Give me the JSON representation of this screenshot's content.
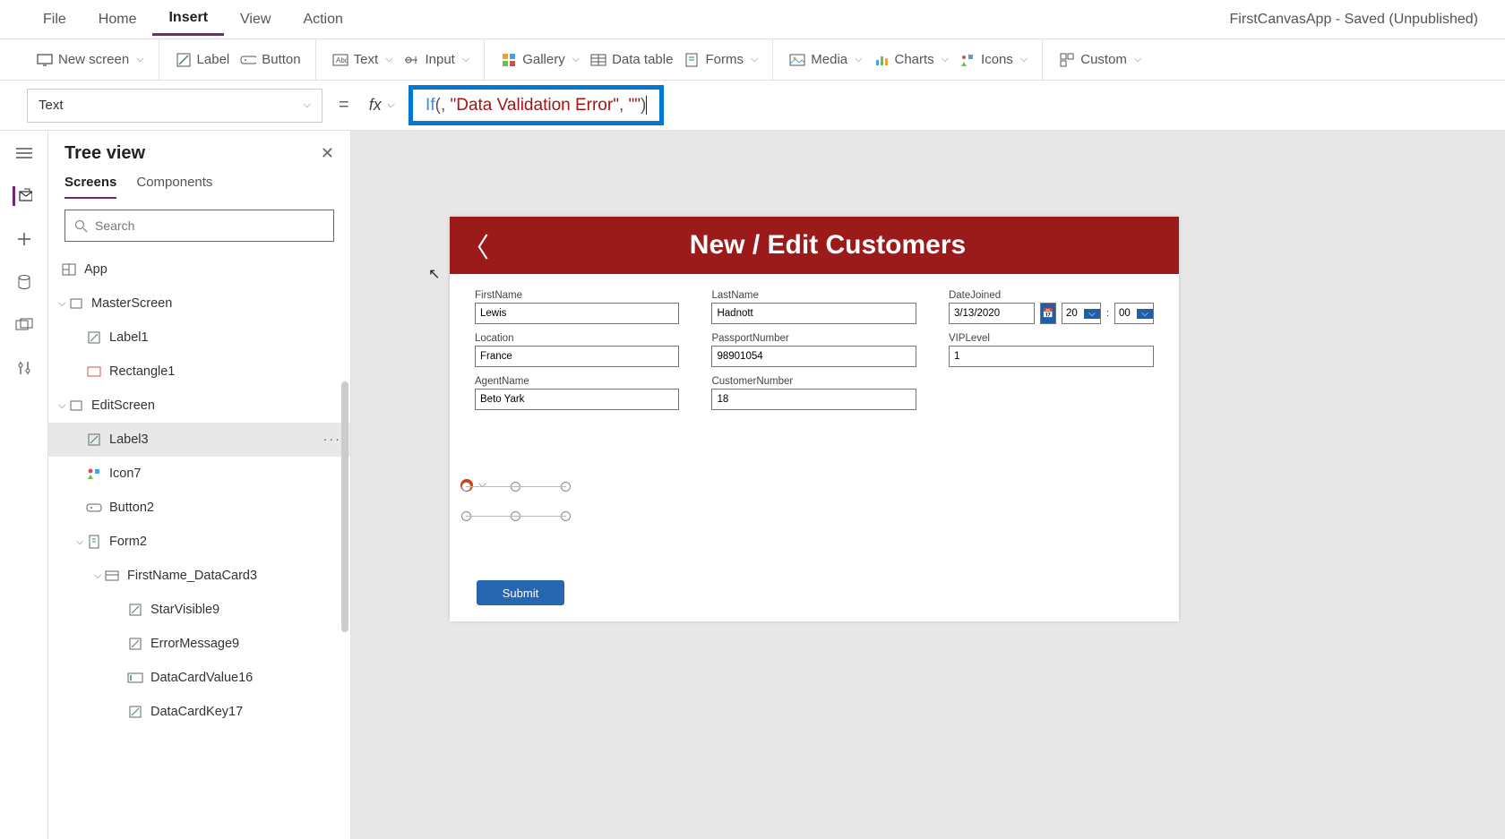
{
  "app": {
    "title": "FirstCanvasApp - Saved (Unpublished)"
  },
  "menubar": [
    "File",
    "Home",
    "Insert",
    "View",
    "Action"
  ],
  "menubar_active": "Insert",
  "ribbon": {
    "new_screen": "New screen",
    "label": "Label",
    "button": "Button",
    "text": "Text",
    "input": "Input",
    "gallery": "Gallery",
    "datatable": "Data table",
    "forms": "Forms",
    "media": "Media",
    "charts": "Charts",
    "icons": "Icons",
    "custom": "Custom"
  },
  "formula": {
    "property": "Text",
    "fx": "fx",
    "fn": "If",
    "open": "(",
    "arg_sep": ", ",
    "str1": "\"Data Validation Error\"",
    "str2": "\"\"",
    "close": ")"
  },
  "treepanel": {
    "title": "Tree view",
    "tabs": [
      "Screens",
      "Components"
    ],
    "active_tab": "Screens",
    "search_placeholder": "Search",
    "items": {
      "app": "App",
      "master": "MasterScreen",
      "label1": "Label1",
      "rectangle1": "Rectangle1",
      "editscreen": "EditScreen",
      "label3": "Label3",
      "icon7": "Icon7",
      "button2": "Button2",
      "form2": "Form2",
      "datacard": "FirstName_DataCard3",
      "starvisible": "StarVisible9",
      "errormsg": "ErrorMessage9",
      "dcvalue": "DataCardValue16",
      "dckey": "DataCardKey17"
    }
  },
  "canvas": {
    "header": "New / Edit Customers",
    "fields": {
      "firstname_lbl": "FirstName",
      "firstname_val": "Lewis",
      "lastname_lbl": "LastName",
      "lastname_val": "Hadnott",
      "datejoined_lbl": "DateJoined",
      "date_val": "3/13/2020",
      "hour_val": "20",
      "min_val": "00",
      "location_lbl": "Location",
      "location_val": "France",
      "passport_lbl": "PassportNumber",
      "passport_val": "98901054",
      "vip_lbl": "VIPLevel",
      "vip_val": "1",
      "agent_lbl": "AgentName",
      "agent_val": "Beto Yark",
      "custnum_lbl": "CustomerNumber",
      "custnum_val": "18"
    },
    "submit": "Submit"
  }
}
